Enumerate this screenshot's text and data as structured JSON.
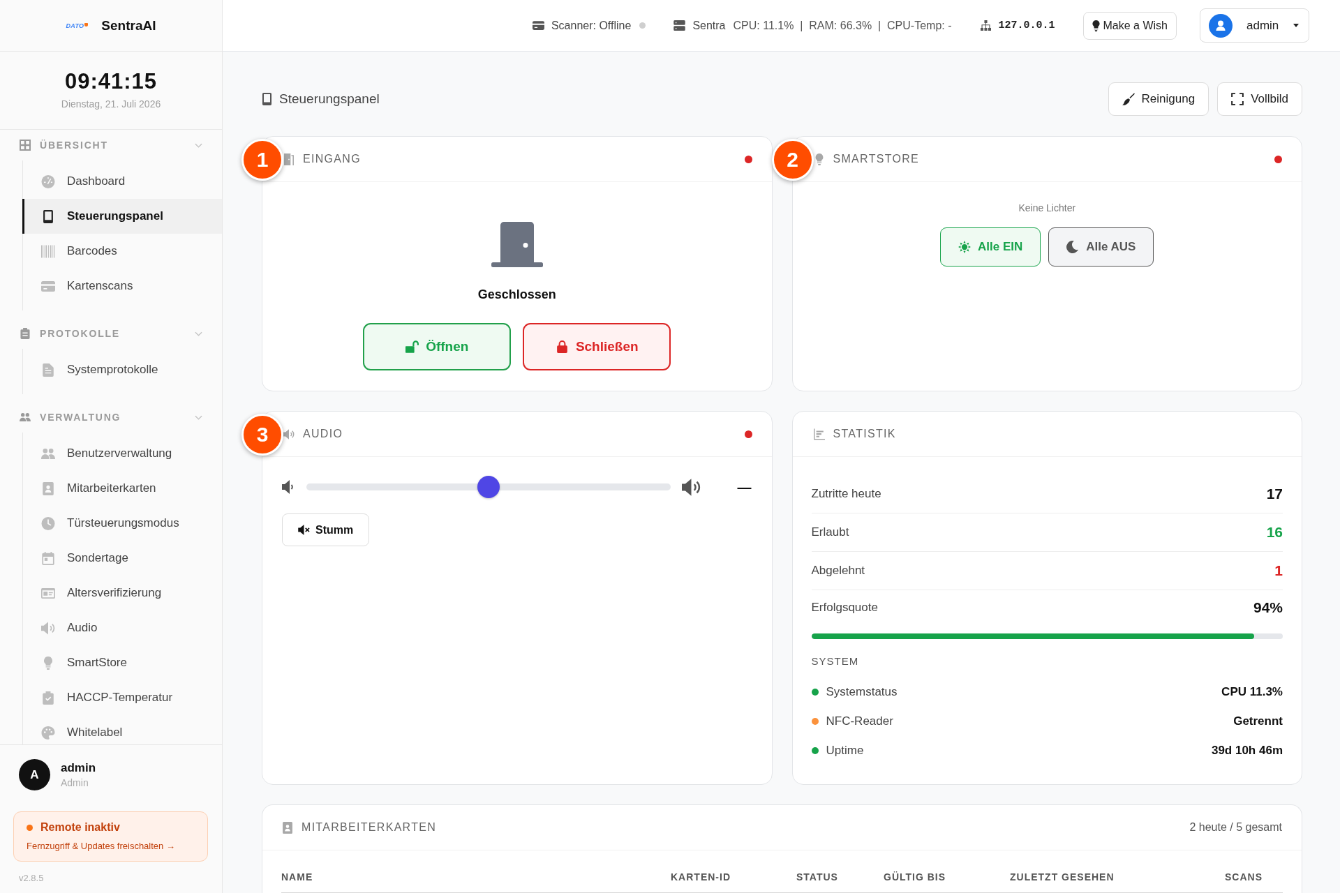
{
  "sidebar": {
    "logo": {
      "mark": "DATO",
      "name": "SentraAI"
    },
    "clock": {
      "time": "09:41:15",
      "date": "Dienstag, 21. Juli 2026"
    },
    "sections": [
      {
        "title": "ÜBERSICHT",
        "expanded": true,
        "items": [
          {
            "label": "Dashboard",
            "selected": false
          },
          {
            "label": "Steuerungspanel",
            "selected": true
          },
          {
            "label": "Barcodes",
            "selected": false
          },
          {
            "label": "Kartenscans",
            "selected": false
          }
        ]
      },
      {
        "title": "PROTOKOLLE",
        "expanded": true,
        "items": [
          {
            "label": "Systemprotokolle",
            "selected": false
          }
        ]
      },
      {
        "title": "VERWALTUNG",
        "expanded": true,
        "items": [
          {
            "label": "Benutzerverwaltung",
            "selected": false
          },
          {
            "label": "Mitarbeiterkarten",
            "selected": false
          },
          {
            "label": "Türsteuerungsmodus",
            "selected": false
          },
          {
            "label": "Sondertage",
            "selected": false
          },
          {
            "label": "Altersverifizierung",
            "selected": false
          },
          {
            "label": "Audio",
            "selected": false
          },
          {
            "label": "SmartStore",
            "selected": false
          },
          {
            "label": "HACCP-Temperatur",
            "selected": false
          },
          {
            "label": "Whitelabel",
            "selected": false
          }
        ]
      }
    ],
    "user": {
      "initial": "A",
      "name": "admin",
      "role": "Admin"
    },
    "remote_notice": {
      "title": "Remote inaktiv",
      "link": "Fernzugriff & Updates freischalten →"
    },
    "version": "v2.8.5"
  },
  "topbar": {
    "scanner": {
      "label": "Scanner: Offline",
      "online": false
    },
    "server": {
      "name": "Sentra",
      "stats": "CPU: 11.1%  |  RAM: 66.3%  |  CPU-Temp: -"
    },
    "ip_address": "127.0.0.1",
    "wish_button": "Make a Wish",
    "user_menu": "admin"
  },
  "page": {
    "title": "Steuerungspanel",
    "actions": [
      "Reinigung",
      "Vollbild"
    ]
  },
  "eingang": {
    "badge": "1",
    "title": "EINGANG",
    "connected": false,
    "state": "Geschlossen",
    "buttons": [
      {
        "label": "Öffnen",
        "kind": "success"
      },
      {
        "label": "Schließen",
        "kind": "danger"
      }
    ]
  },
  "smartstore": {
    "badge": "2",
    "title": "SMARTSTORE",
    "connected": false,
    "message": "Keine Lichter",
    "buttons": [
      {
        "label": "Alle EIN",
        "kind": "success"
      },
      {
        "label": "Alle AUS",
        "kind": "neutral"
      }
    ]
  },
  "audio": {
    "badge": "3",
    "title": "AUDIO",
    "connected": false,
    "volume": {
      "level": 0.5,
      "reading": "—"
    },
    "mute_button": "Stumm"
  },
  "statistik": {
    "title": "STATISTIK",
    "rows": [
      {
        "label": "Zutritte heute",
        "value": "17",
        "color": "#111111"
      },
      {
        "label": "Erlaubt",
        "value": "16",
        "color": "#16a34a"
      },
      {
        "label": "Abgelehnt",
        "value": "1",
        "color": "#dc2626"
      },
      {
        "label": "Erfolgsquote",
        "value": "94%",
        "color": "#111111"
      }
    ],
    "success_bar": {
      "level": 0.94
    },
    "system": {
      "title": "SYSTEM",
      "items": [
        {
          "label": "Systemstatus",
          "value": "CPU 11.3%",
          "color": "#16a34a"
        },
        {
          "label": "NFC-Reader",
          "value": "Getrennt",
          "color": "#fb923c"
        },
        {
          "label": "Uptime",
          "value": "39d 10h 46m",
          "color": "#16a34a"
        }
      ]
    }
  },
  "mitarbeiterkarten": {
    "title": "MITARBEITERKARTEN",
    "summary": "2 heute / 5 gesamt",
    "table": {
      "columns": [
        "NAME",
        "KARTEN-ID",
        "STATUS",
        "GÜLTIG BIS",
        "ZULETZT GESEHEN",
        "SCANS"
      ]
    }
  }
}
